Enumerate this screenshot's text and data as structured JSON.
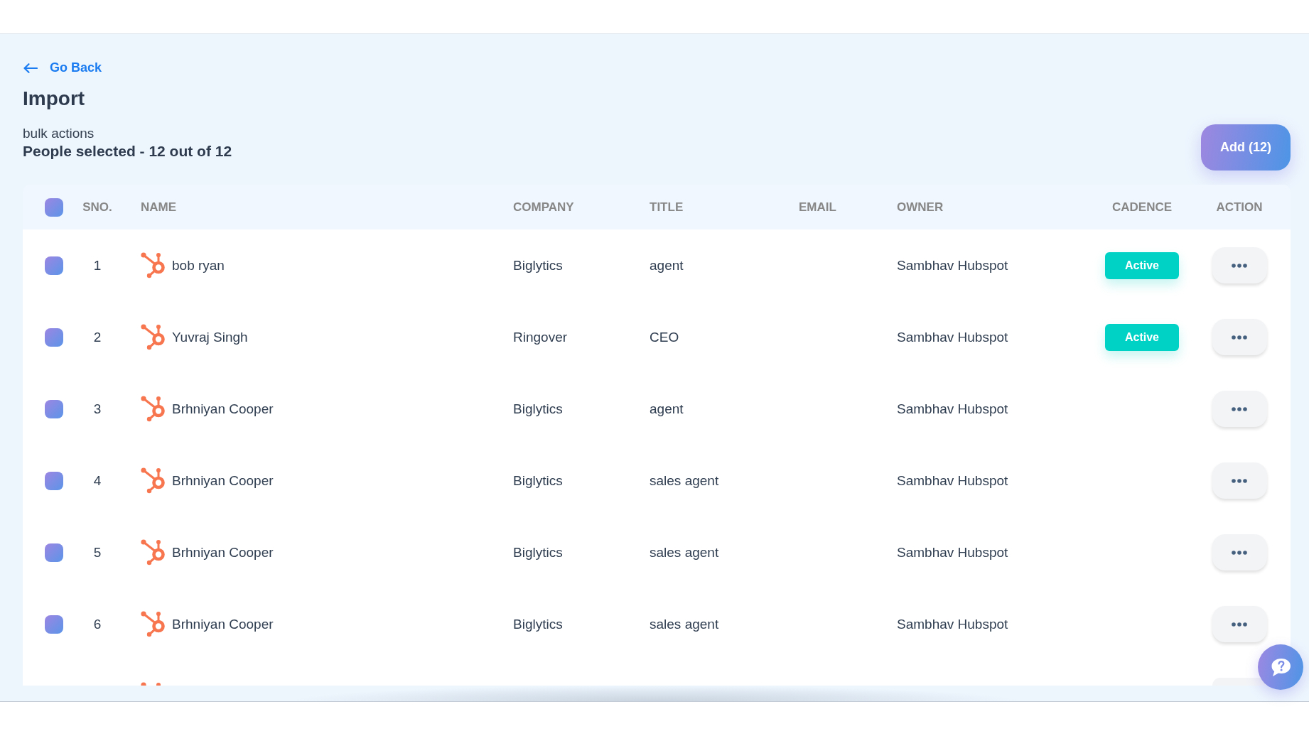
{
  "back_link": {
    "label": "Go Back"
  },
  "page_title": "Import",
  "bulk": {
    "label": "bulk actions",
    "selection_summary": "People selected - 12 out of 12"
  },
  "add_button": {
    "label": "Add (12)"
  },
  "table": {
    "select_all": {
      "checked": true
    },
    "columns": [
      "SNO.",
      "NAME",
      "COMPANY",
      "TITLE",
      "EMAIL",
      "OWNER",
      "CADENCE",
      "ACTION"
    ],
    "rows": [
      {
        "checked": true,
        "sno": "1",
        "name": "bob ryan",
        "company": "Biglytics",
        "title": "agent",
        "owner": "Sambhav Hubspot",
        "cadence": "Active"
      },
      {
        "checked": true,
        "sno": "2",
        "name": "Yuvraj Singh",
        "company": "Ringover",
        "title": "CEO",
        "owner": "Sambhav Hubspot",
        "cadence": "Active"
      },
      {
        "checked": true,
        "sno": "3",
        "name": "Brhniyan Cooper",
        "company": "Biglytics",
        "title": "agent",
        "owner": "Sambhav Hubspot"
      },
      {
        "checked": true,
        "sno": "4",
        "name": "Brhniyan Cooper",
        "company": "Biglytics",
        "title": "sales agent",
        "owner": "Sambhav Hubspot"
      },
      {
        "checked": true,
        "sno": "5",
        "name": "Brhniyan Cooper",
        "company": "Biglytics",
        "title": "sales agent",
        "owner": "Sambhav Hubspot"
      },
      {
        "checked": true,
        "sno": "6",
        "name": "Brhniyan Cooper",
        "company": "Biglytics",
        "title": "sales agent",
        "owner": "Sambhav Hubspot"
      }
    ]
  }
}
